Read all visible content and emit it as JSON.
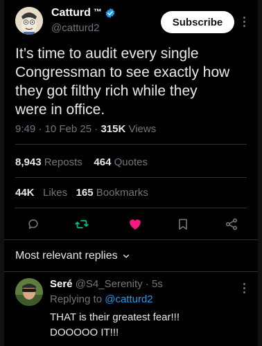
{
  "author": {
    "name": "Catturd",
    "tm": "™",
    "handle": "@catturd2"
  },
  "subscribe_label": "Subscribe",
  "tweet": {
    "text_lines": [
      "It’s time to audit every single",
      "Congressman to see exactly how",
      "they got filthy rich while they",
      "were in office."
    ],
    "time": "9:49",
    "date": "10 Feb 25",
    "views_count": "315K",
    "views_label": "Views"
  },
  "stats": {
    "reposts_count": "8,943",
    "reposts_label": "Reposts",
    "quotes_count": "464",
    "quotes_label": "Quotes",
    "likes_count": "44K",
    "likes_label": "Likes",
    "bookmarks_count": "165",
    "bookmarks_label": "Bookmarks"
  },
  "actions": {
    "icons": [
      "reply-icon",
      "repost-icon",
      "like-icon",
      "bookmark-icon",
      "share-icon"
    ]
  },
  "replies_section": {
    "title": "Most relevant replies"
  },
  "reply": {
    "name": "Seré",
    "handle": "@S4_Serenity",
    "time": "5s",
    "replying_prefix": "Replying to",
    "replying_to": "@catturd2",
    "text_lines": [
      "THAT is their greatest fear!!!",
      "DOOOOO IT!!!"
    ]
  },
  "colors": {
    "background": "#000000",
    "text": "#e7e9ea",
    "muted": "#71767b",
    "accent": "#1d9bf0",
    "like": "#f91880",
    "repost": "#00ba7c"
  }
}
